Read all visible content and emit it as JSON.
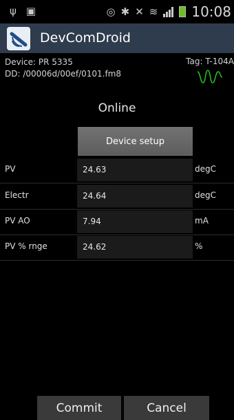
{
  "status_bar": {
    "time": "10:08",
    "icons": [
      "usb-icon",
      "sd-card-icon",
      "eye-icon",
      "bluetooth-icon",
      "mute-icon",
      "wifi-icon",
      "signal-icon",
      "battery-charging-icon"
    ]
  },
  "app": {
    "title": "DevComDroid"
  },
  "device": {
    "device_line": "Device: PR 5335",
    "dd_line": "DD: /00006d/00ef/0101.fm8",
    "tag_line": "Tag: T-104A"
  },
  "connection_status": "Online",
  "device_setup_label": "Device setup",
  "rows": [
    {
      "label": "PV",
      "value": "24.63",
      "unit": "degC"
    },
    {
      "label": "Electr",
      "value": "24.64",
      "unit": "degC"
    },
    {
      "label": "PV AO",
      "value": "7.94",
      "unit": "mA"
    },
    {
      "label": "PV % rnge",
      "value": "24.62",
      "unit": "%"
    }
  ],
  "buttons": {
    "commit": "Commit",
    "cancel": "Cancel"
  },
  "colors": {
    "action_bar": "#2e3c4d",
    "wave": "#27c41e",
    "background": "#000000"
  }
}
